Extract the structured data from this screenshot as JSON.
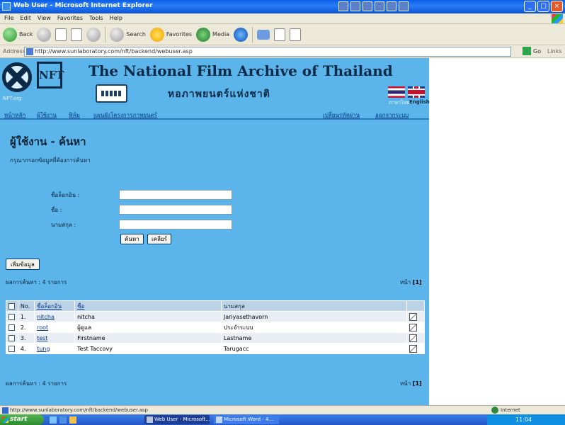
{
  "window": {
    "title": "Web User - Microsoft Internet Explorer",
    "controls": [
      "_",
      "□",
      "×"
    ]
  },
  "menu": [
    "File",
    "Edit",
    "View",
    "Favorites",
    "Tools",
    "Help"
  ],
  "toolbar": {
    "back": "Back",
    "search": "Search",
    "favorites": "Favorites",
    "media": "Media"
  },
  "address": {
    "label": "Address",
    "url": "http://www.sunlaboratory.com/nft/backend/webuser.asp",
    "go": "Go",
    "links": "Links"
  },
  "banner": {
    "logo_label": "NFT.org",
    "nft_mark": "NFT",
    "title": "The National Film Archive of Thailand",
    "thai_title": "หอภาพยนตร์แห่งชาติ",
    "lang_thai": "ภาษาไทย",
    "lang_en": "English"
  },
  "nav": {
    "left": [
      "หน้าหลัก",
      "ผู้ใช้งาน",
      "ฟิล์ม",
      "แผนผังโครงการภาพยนตร์"
    ],
    "right": [
      "เปลี่ยนรหัสผ่าน",
      "ออกจากระบบ"
    ]
  },
  "page": {
    "heading": "ผู้ใช้งาน - ค้นหา",
    "instruction": "กรุณากรอกข้อมูลที่ต้องการค้นหา"
  },
  "form": {
    "username_label": "ชื่อล็อกอิน :",
    "firstname_label": "ชื่อ :",
    "lastname_label": "นามสกุล :",
    "username_value": "",
    "firstname_value": "",
    "lastname_value": "",
    "search_button": "ค้นหา",
    "reset_button": "เคลียร์",
    "add_button": "เพิ่มข้อมูล"
  },
  "results": {
    "count_text": "ผลการค้นหา : 4 รายการ",
    "pager_label": "หน้า",
    "pager_current": "[1]"
  },
  "table": {
    "headers": {
      "no": "No.",
      "username": "ชื่อล็อกอิน",
      "firstname": "ชื่อ",
      "lastname": "นามสกุล"
    },
    "rows": [
      {
        "no": "1.",
        "username": "nitcha",
        "firstname": "nitcha",
        "lastname": "Jariyasethavorn"
      },
      {
        "no": "2.",
        "username": "root",
        "firstname": "ผู้ดูแล",
        "lastname": "ประจำระบบ"
      },
      {
        "no": "3.",
        "username": "test",
        "firstname": "Firstname",
        "lastname": "Lastname"
      },
      {
        "no": "4.",
        "username": "tung",
        "firstname": "Test Taccovy",
        "lastname": "Tarugacc"
      }
    ]
  },
  "statusbar": {
    "url": "http://www.sunlaboratory.com/nft/backend/webuser.asp",
    "zone": "Internet"
  },
  "taskbar": {
    "start": "start",
    "tasks": [
      "Web User - Microsoft...",
      "Microsoft Word - 4..."
    ],
    "clock": "11:04"
  }
}
